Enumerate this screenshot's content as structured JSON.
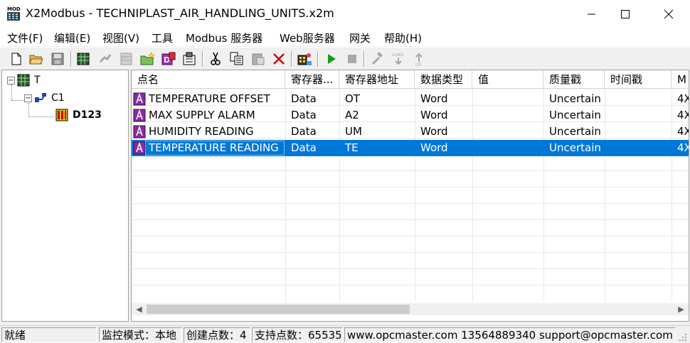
{
  "window": {
    "title": "X2Modbus - TECHNIPLAST_AIR_HANDLING_UNITS.x2m",
    "icon_text": "MOD"
  },
  "menu": [
    {
      "label": "文件(F)"
    },
    {
      "label": "编辑(E)"
    },
    {
      "label": "视图(V)"
    },
    {
      "label": "工具"
    },
    {
      "label": "Modbus 服务器"
    },
    {
      "label": "Web服务器"
    },
    {
      "label": "网关"
    },
    {
      "label": "帮助(H)"
    }
  ],
  "tree": {
    "root": {
      "label": "T"
    },
    "channel": {
      "label": "C1"
    },
    "device": {
      "label": "D123"
    }
  },
  "columns": [
    {
      "label": "点名"
    },
    {
      "label": "寄存器..."
    },
    {
      "label": "寄存器地址"
    },
    {
      "label": "数据类型"
    },
    {
      "label": "值"
    },
    {
      "label": "质量戳"
    },
    {
      "label": "时间戳"
    },
    {
      "label": "M"
    }
  ],
  "rows": [
    {
      "name": "TEMPERATURE OFFSET",
      "register": "Data",
      "address": "OT",
      "type": "Word",
      "value": "",
      "quality": "Uncertain",
      "timestamp": "",
      "m": "4X",
      "selected": false
    },
    {
      "name": "MAX SUPPLY ALARM",
      "register": "Data",
      "address": "A2",
      "type": "Word",
      "value": "",
      "quality": "Uncertain",
      "timestamp": "",
      "m": "4X",
      "selected": false
    },
    {
      "name": "HUMIDITY READING",
      "register": "Data",
      "address": "UM",
      "type": "Word",
      "value": "",
      "quality": "Uncertain",
      "timestamp": "",
      "m": "4X",
      "selected": false
    },
    {
      "name": "TEMPERATURE READING",
      "register": "Data",
      "address": "TE",
      "type": "Word",
      "value": "",
      "quality": "Uncertain",
      "timestamp": "",
      "m": "4X",
      "selected": true
    }
  ],
  "statusbar": {
    "ready": "就绪",
    "mode": "监控模式：本地",
    "created": "创建点数：4",
    "supported": "支持点数：65535",
    "contact": "www.opcmaster.com 13564889340 support@opcmaster.com"
  },
  "colors": {
    "selection": "#0078d7",
    "tag_icon": "#7b2d8b"
  }
}
